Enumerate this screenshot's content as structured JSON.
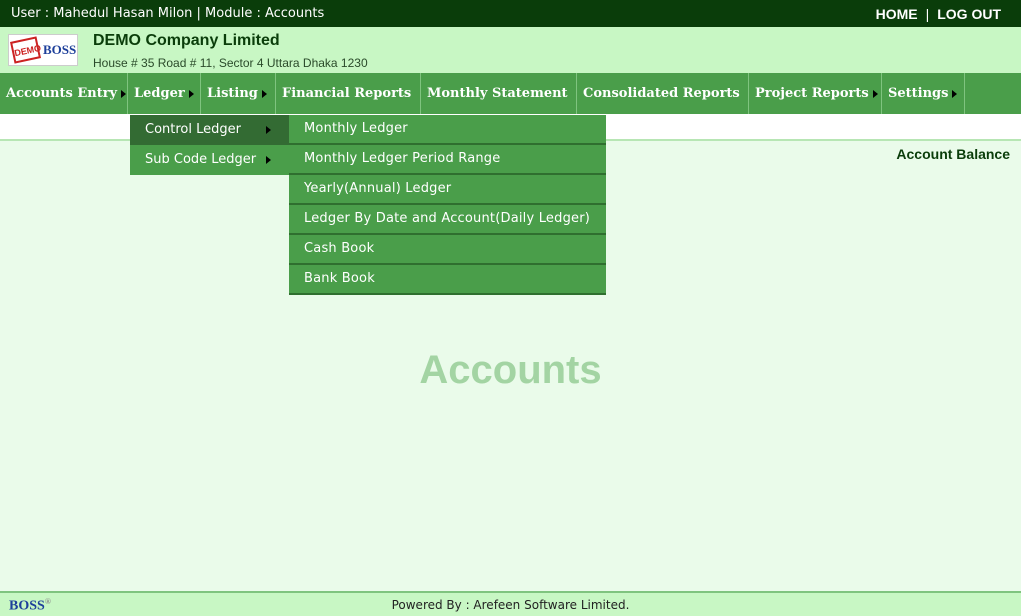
{
  "topbar": {
    "user_text": "User : Mahedul Hasan Milon  | Module : Accounts",
    "home": "HOME",
    "sep": "|",
    "logout": "LOG OUT"
  },
  "header": {
    "logo_demo": "DEMO",
    "logo_boss": "BOSS",
    "company": "DEMO Company Limited",
    "address": "House # 35 Road # 11, Sector 4 Uttara Dhaka 1230"
  },
  "menu": [
    {
      "label": "Accounts Entry"
    },
    {
      "label": "Ledger"
    },
    {
      "label": "Listing"
    },
    {
      "label": "Financial Reports"
    },
    {
      "label": "Monthly Statement"
    },
    {
      "label": "Consolidated Reports"
    },
    {
      "label": "Project Reports"
    },
    {
      "label": "Settings"
    }
  ],
  "ledger_submenu": [
    {
      "label": "Control Ledger"
    },
    {
      "label": "Sub Code Ledger"
    }
  ],
  "control_ledger_submenu": [
    {
      "label": "Monthly Ledger"
    },
    {
      "label": "Monthly Ledger Period Range"
    },
    {
      "label": "Yearly(Annual) Ledger"
    },
    {
      "label": "Ledger By Date and Account(Daily Ledger)"
    },
    {
      "label": "Cash Book"
    },
    {
      "label": "Bank Book"
    }
  ],
  "account_balance": "Account Balance",
  "main_title": "Accounts",
  "footer": {
    "logo": "BOSS",
    "powered_by": "Powered By : Arefeen Software Limited."
  },
  "colors": {
    "topbar": "#0a3d0a",
    "menubar": "#4a9e4a",
    "header_bg": "#c8f7c4",
    "page_bg": "#eafbea"
  }
}
